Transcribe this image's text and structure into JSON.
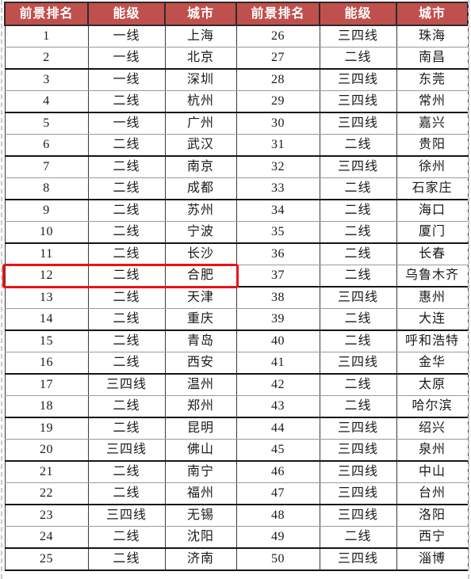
{
  "table": {
    "headers": [
      "前景排名",
      "能级",
      "城市",
      "前景排名",
      "能级",
      "城市"
    ],
    "header_bg": "#c0504d",
    "header_text_color": "#ffffff",
    "grid_color": "#151515",
    "highlight": {
      "color": "#ee1111",
      "row_index": 11,
      "side": "left",
      "rank": "12",
      "tier": "二线",
      "city": "合肥"
    },
    "left_rows": [
      {
        "rank": "1",
        "tier": "一线",
        "city": "上海"
      },
      {
        "rank": "2",
        "tier": "一线",
        "city": "北京"
      },
      {
        "rank": "3",
        "tier": "一线",
        "city": "深圳"
      },
      {
        "rank": "4",
        "tier": "二线",
        "city": "杭州"
      },
      {
        "rank": "5",
        "tier": "一线",
        "city": "广州"
      },
      {
        "rank": "6",
        "tier": "二线",
        "city": "武汉"
      },
      {
        "rank": "7",
        "tier": "二线",
        "city": "南京"
      },
      {
        "rank": "8",
        "tier": "二线",
        "city": "成都"
      },
      {
        "rank": "9",
        "tier": "二线",
        "city": "苏州"
      },
      {
        "rank": "10",
        "tier": "二线",
        "city": "宁波"
      },
      {
        "rank": "11",
        "tier": "二线",
        "city": "长沙"
      },
      {
        "rank": "12",
        "tier": "二线",
        "city": "合肥"
      },
      {
        "rank": "13",
        "tier": "二线",
        "city": "天津"
      },
      {
        "rank": "14",
        "tier": "二线",
        "city": "重庆"
      },
      {
        "rank": "15",
        "tier": "二线",
        "city": "青岛"
      },
      {
        "rank": "16",
        "tier": "二线",
        "city": "西安"
      },
      {
        "rank": "17",
        "tier": "三四线",
        "city": "温州"
      },
      {
        "rank": "18",
        "tier": "二线",
        "city": "郑州"
      },
      {
        "rank": "19",
        "tier": "二线",
        "city": "昆明"
      },
      {
        "rank": "20",
        "tier": "三四线",
        "city": "佛山"
      },
      {
        "rank": "21",
        "tier": "二线",
        "city": "南宁"
      },
      {
        "rank": "22",
        "tier": "二线",
        "city": "福州"
      },
      {
        "rank": "23",
        "tier": "三四线",
        "city": "无锡"
      },
      {
        "rank": "24",
        "tier": "二线",
        "city": "沈阳"
      },
      {
        "rank": "25",
        "tier": "二线",
        "city": "济南"
      }
    ],
    "right_rows": [
      {
        "rank": "26",
        "tier": "三四线",
        "city": "珠海"
      },
      {
        "rank": "27",
        "tier": "二线",
        "city": "南昌"
      },
      {
        "rank": "28",
        "tier": "三四线",
        "city": "东莞"
      },
      {
        "rank": "29",
        "tier": "三四线",
        "city": "常州"
      },
      {
        "rank": "30",
        "tier": "三四线",
        "city": "嘉兴"
      },
      {
        "rank": "31",
        "tier": "二线",
        "city": "贵阳"
      },
      {
        "rank": "32",
        "tier": "三四线",
        "city": "徐州"
      },
      {
        "rank": "33",
        "tier": "二线",
        "city": "石家庄"
      },
      {
        "rank": "34",
        "tier": "二线",
        "city": "海口"
      },
      {
        "rank": "35",
        "tier": "二线",
        "city": "厦门"
      },
      {
        "rank": "36",
        "tier": "二线",
        "city": "长春"
      },
      {
        "rank": "37",
        "tier": "二线",
        "city": "乌鲁木齐"
      },
      {
        "rank": "38",
        "tier": "三四线",
        "city": "惠州"
      },
      {
        "rank": "39",
        "tier": "二线",
        "city": "大连"
      },
      {
        "rank": "40",
        "tier": "二线",
        "city": "呼和浩特"
      },
      {
        "rank": "41",
        "tier": "三四线",
        "city": "金华"
      },
      {
        "rank": "42",
        "tier": "二线",
        "city": "太原"
      },
      {
        "rank": "43",
        "tier": "二线",
        "city": "哈尔滨"
      },
      {
        "rank": "44",
        "tier": "三四线",
        "city": "绍兴"
      },
      {
        "rank": "45",
        "tier": "三四线",
        "city": "泉州"
      },
      {
        "rank": "46",
        "tier": "三四线",
        "city": "中山"
      },
      {
        "rank": "47",
        "tier": "三四线",
        "city": "台州"
      },
      {
        "rank": "48",
        "tier": "三四线",
        "city": "洛阳"
      },
      {
        "rank": "49",
        "tier": "二线",
        "city": "西宁"
      },
      {
        "rank": "50",
        "tier": "三四线",
        "city": "淄博"
      }
    ]
  }
}
